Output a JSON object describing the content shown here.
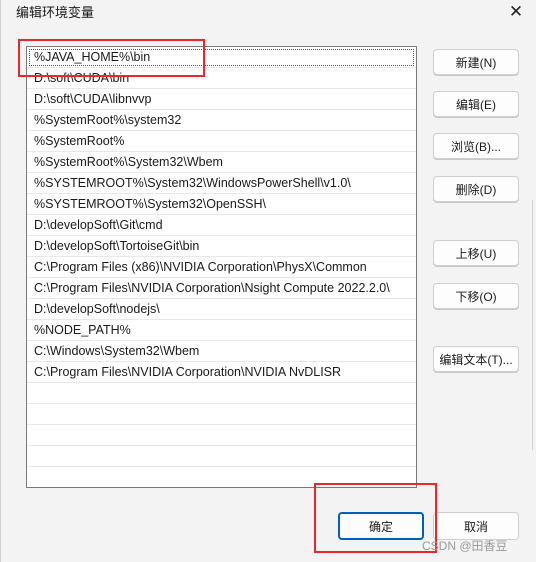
{
  "window": {
    "title": "编辑环境变量",
    "close_symbol": "✕"
  },
  "paths": [
    "%JAVA_HOME%\\bin",
    "D:\\soft\\CUDA\\bin",
    "D:\\soft\\CUDA\\libnvvp",
    "%SystemRoot%\\system32",
    "%SystemRoot%",
    "%SystemRoot%\\System32\\Wbem",
    "%SYSTEMROOT%\\System32\\WindowsPowerShell\\v1.0\\",
    "%SYSTEMROOT%\\System32\\OpenSSH\\",
    "D:\\developSoft\\Git\\cmd",
    "D:\\developSoft\\TortoiseGit\\bin",
    "C:\\Program Files (x86)\\NVIDIA Corporation\\PhysX\\Common",
    "C:\\Program Files\\NVIDIA Corporation\\Nsight Compute 2022.2.0\\",
    "D:\\developSoft\\nodejs\\",
    "%NODE_PATH%",
    "C:\\Windows\\System32\\Wbem",
    "C:\\Program Files\\NVIDIA Corporation\\NVIDIA NvDLISR"
  ],
  "buttons": {
    "new": "新建(N)",
    "edit": "编辑(E)",
    "browse": "浏览(B)...",
    "delete": "删除(D)",
    "move_up": "上移(U)",
    "move_down": "下移(O)",
    "edit_text": "编辑文本(T)...",
    "ok": "确定",
    "cancel": "取消"
  },
  "watermark": "CSDN @田香豆",
  "colors": {
    "highlight": "#e8282a",
    "ok_border": "#005fb8"
  }
}
